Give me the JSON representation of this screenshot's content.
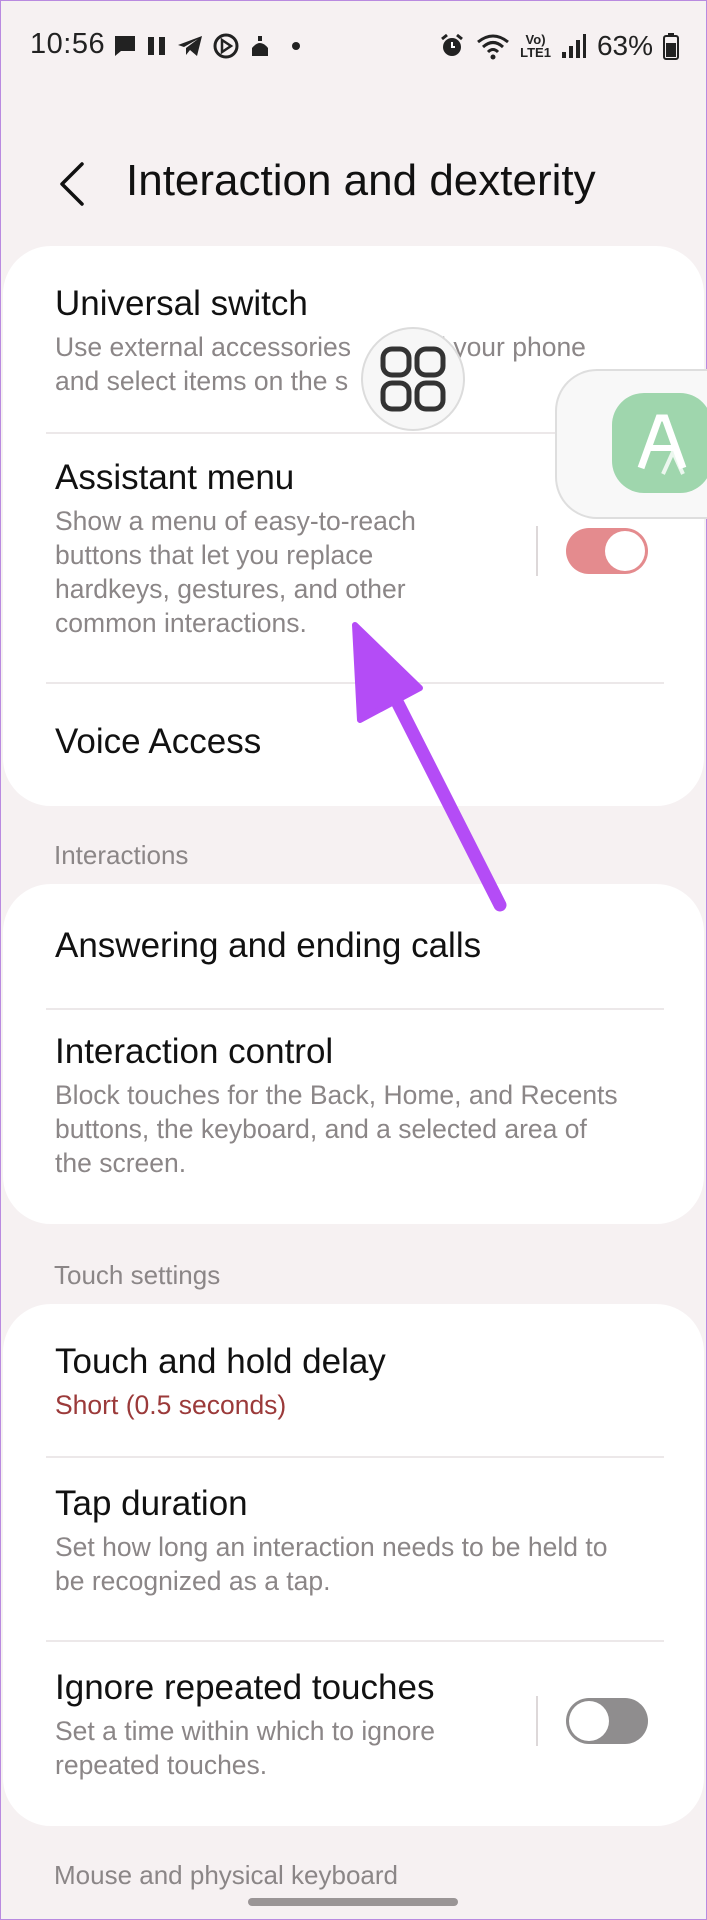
{
  "status_bar": {
    "time": "10:56",
    "battery_percent": "63%",
    "network_label_top": "Vo)",
    "network_label_bottom": "LTE1",
    "left_icons": [
      "chat-icon",
      "pause-icon",
      "telegram-icon",
      "navigation-icon",
      "mosque-icon",
      "dot-icon"
    ],
    "right_icons": [
      "alarm-icon",
      "wifi-icon",
      "signal-icon",
      "battery-icon"
    ]
  },
  "header": {
    "title": "Interaction and dexterity",
    "back_icon": "chevron-left-icon"
  },
  "card1": {
    "universal_switch": {
      "title": "Universal switch",
      "desc_line1": "Use external accessories ",
      "desc_line1_end": "ntrol your phone",
      "desc_line2": "and select items on the s"
    },
    "assistant_menu": {
      "title": "Assistant menu",
      "desc": [
        "Show a menu of easy-to-reach",
        "buttons that let you replace",
        "hardkeys, gestures, and other",
        "common interactions."
      ],
      "toggle_on": true
    },
    "voice_access": {
      "title": "Voice Access"
    }
  },
  "interactions": {
    "section_label": "Interactions",
    "answering_calls": {
      "title": "Answering and ending calls"
    },
    "interaction_control": {
      "title": "Interaction control",
      "desc": [
        "Block touches for the Back, Home, and Recents",
        "buttons, the keyboard, and a selected area of",
        "the screen."
      ]
    }
  },
  "touch_settings": {
    "section_label": "Touch settings",
    "touch_hold_delay": {
      "title": "Touch and hold delay",
      "value": "Short (0.5 seconds)"
    },
    "tap_duration": {
      "title": "Tap duration",
      "desc": [
        "Set how long an interaction needs to be held to",
        "be recognized as a tap."
      ]
    },
    "ignore_repeated": {
      "title": "Ignore repeated touches",
      "desc": [
        "Set a time within which to ignore",
        "repeated touches."
      ],
      "toggle_on": false
    }
  },
  "mouse_keyboard": {
    "section_label": "Mouse and physical keyboard"
  },
  "colors": {
    "background": "#f6f1f2",
    "card": "#ffffff",
    "toggle_on": "#e48b8e",
    "toggle_off": "#8f8d8e",
    "value_text": "#9b3a3a",
    "annotation_arrow": "#b44cf6",
    "accessibility_icon": "#9fd6ad"
  }
}
